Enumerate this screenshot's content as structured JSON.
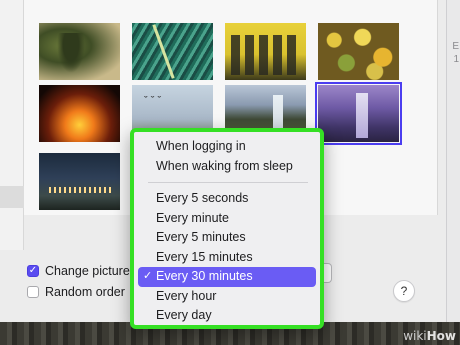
{
  "side_hint": "E\n1",
  "thumbnails": [
    {
      "name": "deer-wallpaper",
      "selected": false
    },
    {
      "name": "peacock-wallpaper",
      "selected": false
    },
    {
      "name": "mariachi-wallpaper",
      "selected": false
    },
    {
      "name": "gourds-wallpaper",
      "selected": false
    },
    {
      "name": "fireplace-wallpaper",
      "selected": false
    },
    {
      "name": "birds-wallpaper",
      "selected": false
    },
    {
      "name": "cliff-waterfall-wallpaper",
      "selected": false
    },
    {
      "name": "purple-waterfall-wallpaper",
      "selected": true
    },
    {
      "name": "night-town-wallpaper",
      "selected": false
    }
  ],
  "options": {
    "change_picture": {
      "label": "Change picture:",
      "checked": true
    },
    "random_order": {
      "label": "Random order",
      "checked": false
    }
  },
  "help_label": "?",
  "menu": {
    "group1": [
      "When logging in",
      "When waking from sleep"
    ],
    "group2": [
      "Every 5 seconds",
      "Every minute",
      "Every 5 minutes",
      "Every 15 minutes",
      "Every 30 minutes",
      "Every hour",
      "Every day"
    ],
    "selected": "Every 30 minutes",
    "check_glyph": "✓"
  },
  "accent_color": "#6a5cf4",
  "highlight_frame_color": "#35e024",
  "watermark": {
    "prefix": "wiki",
    "suffix": "How"
  }
}
